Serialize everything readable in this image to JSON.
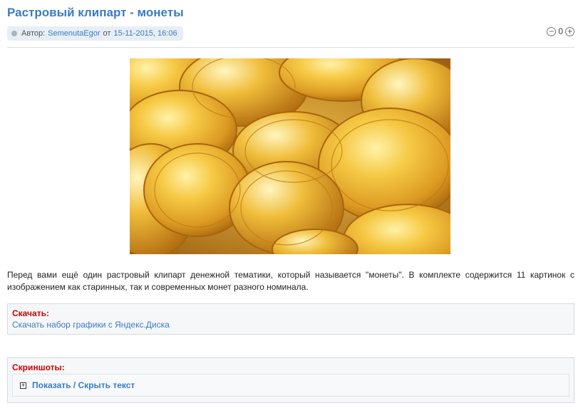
{
  "post": {
    "title": "Растровый клипарт - монеты",
    "meta": {
      "author_prefix": "Автор:",
      "author": "SemenutaEgor",
      "date_prefix": "от",
      "date": "15-11-2015, 16:06"
    },
    "rating": {
      "value": "0",
      "minus_icon": "minus-circle-icon",
      "plus_icon": "plus-circle-icon"
    },
    "image_subject": "gold coins",
    "description": "Перед вами ещё один растровый клипарт денежной тематики, который называется \"монеты\". В комплекте содержится 11 картинок с изображением как старинных, так и современных монет разного номинала.",
    "download": {
      "title": "Скачать:",
      "link": "Скачать набор графики с Яндекс.Диска"
    },
    "screenshots": {
      "title": "Скриншоты:",
      "toggle": "Показать / Скрыть текст"
    }
  },
  "colors": {
    "link": "#3a7bc4",
    "section_title": "#cc0000",
    "gold": "#e0a52a"
  }
}
